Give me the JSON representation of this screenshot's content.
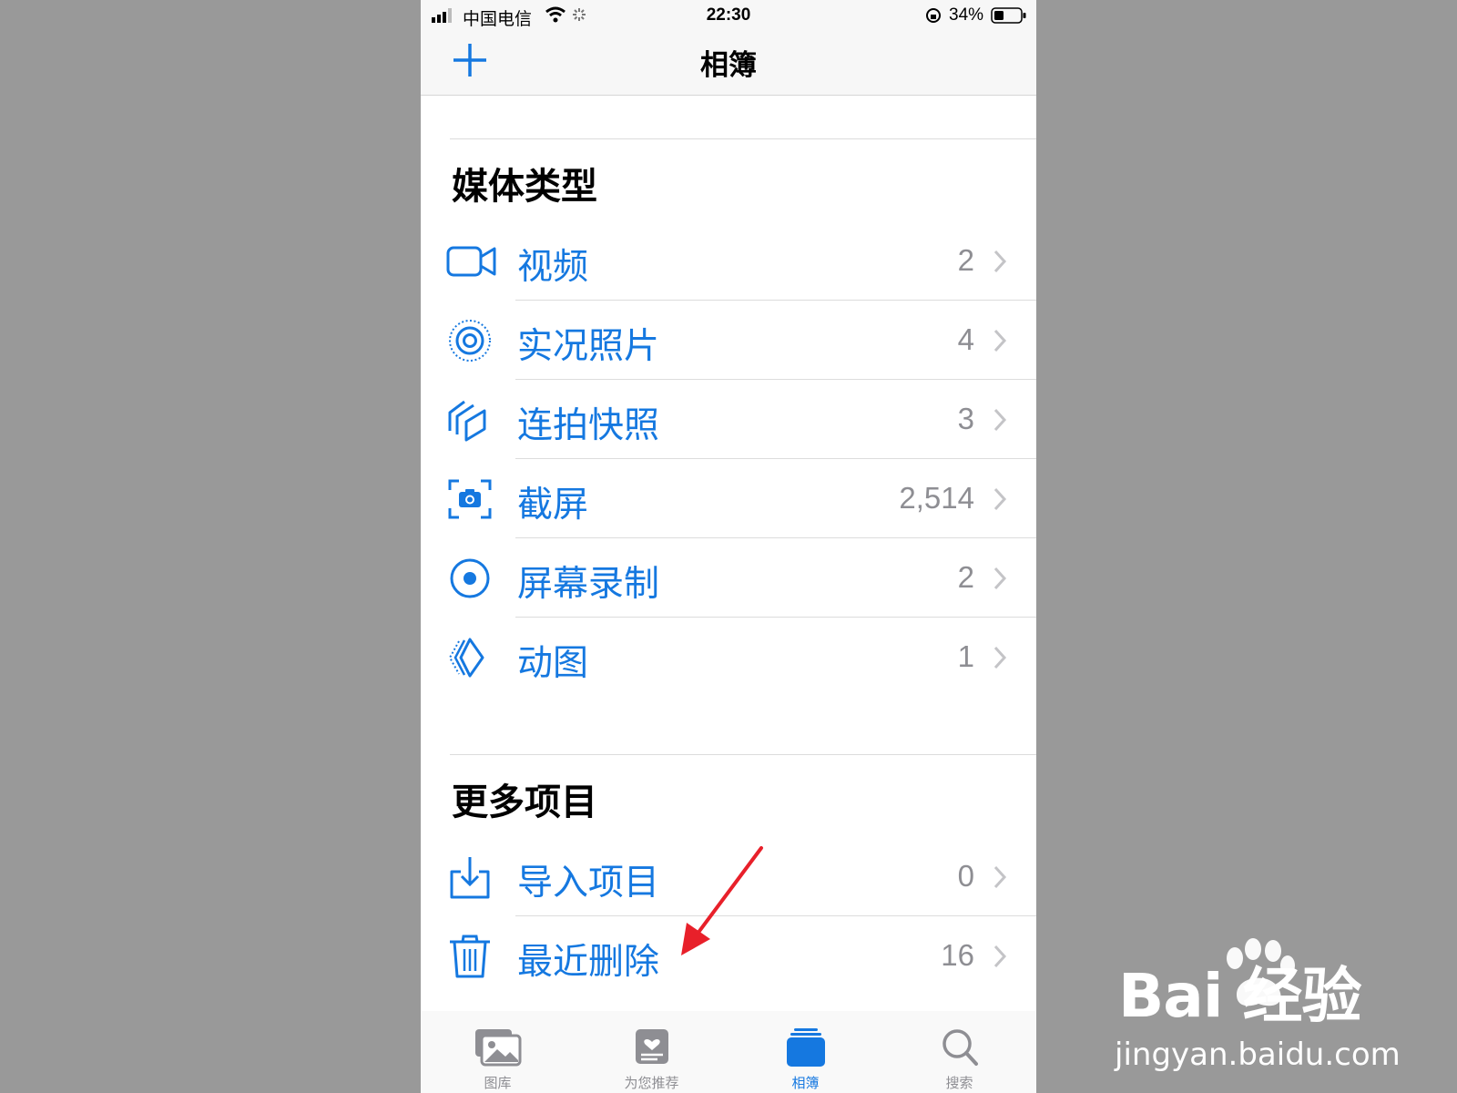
{
  "status_bar": {
    "carrier": "中国电信",
    "time": "22:30",
    "battery": "34%"
  },
  "nav": {
    "title": "相簿",
    "add_icon": "plus-icon"
  },
  "media_types": {
    "title": "媒体类型",
    "items": [
      {
        "label": "视频",
        "count": "2",
        "icon": "video-camera-icon"
      },
      {
        "label": "实况照片",
        "count": "4",
        "icon": "live-photo-icon"
      },
      {
        "label": "连拍快照",
        "count": "3",
        "icon": "burst-icon"
      },
      {
        "label": "截屏",
        "count": "2,514",
        "icon": "screenshot-icon"
      },
      {
        "label": "屏幕录制",
        "count": "2",
        "icon": "screen-record-icon"
      },
      {
        "label": "动图",
        "count": "1",
        "icon": "animated-icon"
      }
    ]
  },
  "more_items": {
    "title": "更多项目",
    "items": [
      {
        "label": "导入项目",
        "count": "0",
        "icon": "import-icon"
      },
      {
        "label": "最近删除",
        "count": "16",
        "icon": "trash-icon"
      }
    ]
  },
  "tab_bar": {
    "tabs": [
      {
        "label": "图库",
        "icon": "photos-icon"
      },
      {
        "label": "为您推荐",
        "icon": "for-you-icon"
      },
      {
        "label": "相簿",
        "icon": "albums-icon",
        "active": true
      },
      {
        "label": "搜索",
        "icon": "search-icon"
      }
    ]
  },
  "watermark": {
    "logo": "Bai 经验",
    "url": "jingyan.baidu.com"
  },
  "colors": {
    "accent": "#1578e0",
    "secondary_text": "#8e8e93",
    "annotation_arrow": "#e8202a"
  }
}
